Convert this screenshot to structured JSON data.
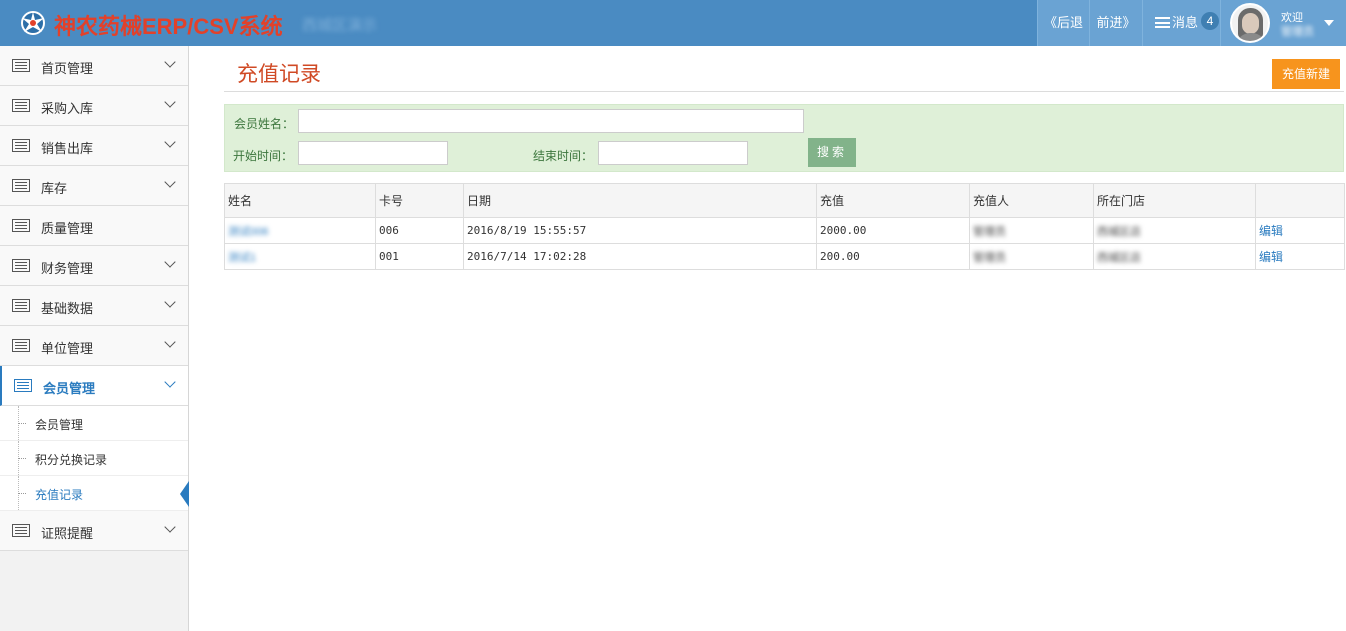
{
  "header": {
    "title": "神农药械ERP/CSV系统",
    "subtitle": "西城区演示",
    "back_label": "《后退",
    "forward_label": "前进》",
    "messages_label": "消息",
    "messages_count": "4",
    "welcome_label": "欢迎",
    "username": "管理员",
    "bar_color": "#4a8bc2"
  },
  "sidebar": {
    "items": [
      {
        "label": "首页管理",
        "icon": "list-icon",
        "expandable": true
      },
      {
        "label": "采购入库",
        "icon": "list-icon",
        "expandable": true
      },
      {
        "label": "销售出库",
        "icon": "list-icon",
        "expandable": true
      },
      {
        "label": "库存",
        "icon": "list-icon",
        "expandable": true
      },
      {
        "label": "质量管理",
        "icon": "list-icon",
        "expandable": false
      },
      {
        "label": "财务管理",
        "icon": "list-icon",
        "expandable": true
      },
      {
        "label": "基础数据",
        "icon": "list-icon",
        "expandable": true
      },
      {
        "label": "单位管理",
        "icon": "list-icon",
        "expandable": true
      },
      {
        "label": "会员管理",
        "icon": "list-icon",
        "expandable": true,
        "active": true
      },
      {
        "label": "证照提醒",
        "icon": "list-icon",
        "expandable": true
      }
    ],
    "subitems": [
      {
        "label": "会员管理"
      },
      {
        "label": "积分兑换记录"
      },
      {
        "label": "充值记录",
        "active": true
      }
    ],
    "accent_color": "#2a7bbf"
  },
  "main": {
    "page_title": "充值记录",
    "new_button_label": "充值新建",
    "filter": {
      "member_name_label": "会员姓名：",
      "member_name_value": "",
      "start_time_label": "开始时间：",
      "start_time_value": "",
      "end_time_label": "结束时间：",
      "end_time_value": "",
      "search_label": "搜索"
    },
    "table": {
      "columns": [
        "姓名",
        "卡号",
        "日期",
        "充值",
        "充值人",
        "所在门店",
        ""
      ],
      "rows": [
        {
          "name": "测试006",
          "card": "006",
          "date": "2016/8/19 15:55:57",
          "amount": "2000.00",
          "operator": "管理员",
          "store": "西城区店",
          "action": "编辑"
        },
        {
          "name": "测试1",
          "card": "001",
          "date": "2016/7/14 17:02:28",
          "amount": "200.00",
          "operator": "管理员",
          "store": "西城区店",
          "action": "编辑"
        }
      ]
    }
  }
}
